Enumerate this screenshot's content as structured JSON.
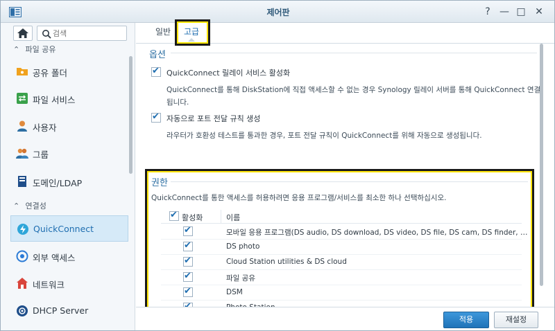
{
  "window": {
    "title": "제어판",
    "controls": [
      "?",
      "—",
      "□",
      "✕"
    ]
  },
  "sidebar": {
    "search_placeholder": "검색",
    "sections": [
      {
        "label": "파일 공유"
      },
      {
        "label": "연결성"
      }
    ],
    "items": [
      {
        "label": "공유 폴더",
        "icon": "shared-folder-icon",
        "color": "#f0a21e"
      },
      {
        "label": "파일 서비스",
        "icon": "file-services-icon",
        "color": "#3aa14b"
      },
      {
        "label": "사용자",
        "icon": "user-icon",
        "color": "#e08a3c"
      },
      {
        "label": "그룹",
        "icon": "group-icon",
        "color": "#e08a3c"
      },
      {
        "label": "도메인/LDAP",
        "icon": "domain-ldap-icon",
        "color": "#1f4e8a"
      },
      {
        "label": "QuickConnect",
        "icon": "quickconnect-icon",
        "color": "#2fa6d9"
      },
      {
        "label": "외부 액세스",
        "icon": "external-access-icon",
        "color": "#2b7bd6"
      },
      {
        "label": "네트워크",
        "icon": "network-icon",
        "color": "#d9453b"
      },
      {
        "label": "DHCP Server",
        "icon": "dhcp-server-icon",
        "color": "#1f4e8a"
      }
    ]
  },
  "tabs": [
    {
      "label": "일반"
    },
    {
      "label": "고급"
    }
  ],
  "options": {
    "title": "옵션",
    "relay": {
      "label": "QuickConnect 릴레이 서비스 활성화",
      "desc_line1": "QuickConnect를 통해 DiskStation에 직접 액세스할 수 없는 경우 Synology 릴레이 서버를 통해 QuickConnect 연결이 중계",
      "desc_line2": "됩니다."
    },
    "portfwd": {
      "label": "자동으로 포트 전달 규칙 생성",
      "desc": "라우터가 호환성 테스트를 통과한 경우, 포트 전달 규칙이 QuickConnect를 위해 자동으로 생성됩니다."
    }
  },
  "permissions": {
    "title": "권한",
    "desc": "QuickConnect를 통한 액세스를 허용하려면 응용 프로그램/서비스를 최소한 하나 선택하십시오.",
    "col_enable": "활성화",
    "col_name": "이름",
    "rows": [
      {
        "name": "모바일 응용 프로그램(DS audio, DS download, DS video, DS file, DS cam, DS finder, DS note,...",
        "checked": true
      },
      {
        "name": "DS photo",
        "checked": true
      },
      {
        "name": "Cloud Station utilities & DS cloud",
        "checked": true
      },
      {
        "name": "파일 공유",
        "checked": true
      },
      {
        "name": "DSM",
        "checked": true
      },
      {
        "name": "Photo Station",
        "checked": true
      }
    ]
  },
  "footer": {
    "apply": "적용",
    "reset": "재설정"
  }
}
